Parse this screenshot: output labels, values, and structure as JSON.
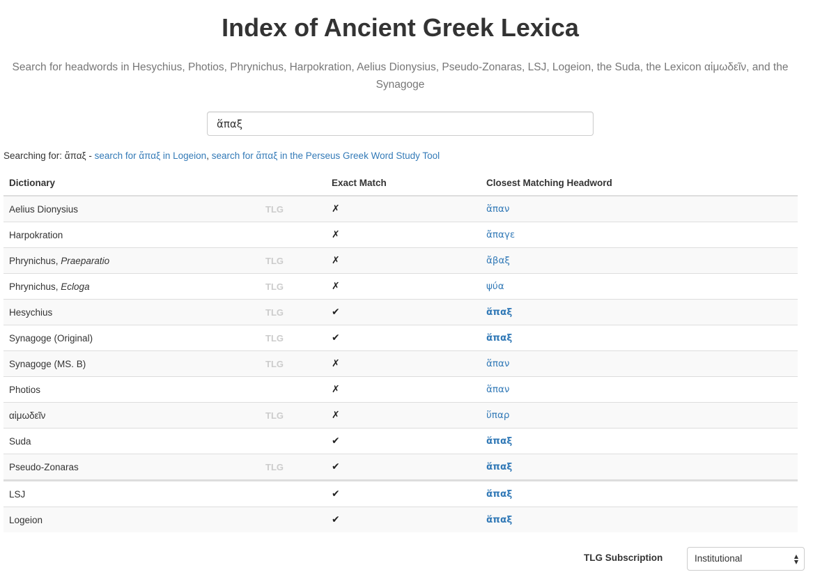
{
  "page": {
    "title": "Index of Ancient Greek Lexica",
    "subtitle": "Search for headwords in Hesychius, Photios, Phrynichus, Harpokration, Aelius Dionysius, Pseudo-Zonaras, LSJ, Logeion, the Suda, the Lexicon αἱμωδεῖν, and the Synagoge"
  },
  "search": {
    "value": "ἅπαξ",
    "searching_prefix": "Searching for: ἅπαξ - ",
    "logeion_link": "search for ἅπαξ in Logeion",
    "separator": ", ",
    "perseus_link": "search for ἅπαξ in the Perseus Greek Word Study Tool"
  },
  "table": {
    "headers": {
      "dictionary": "Dictionary",
      "tlg": "",
      "exact": "Exact Match",
      "closest": "Closest Matching Headword"
    },
    "rows": [
      {
        "name": "Aelius Dionysius",
        "italic": "",
        "tlg": "TLG",
        "exact": "✗",
        "headword": "ἅπαν",
        "bold": false
      },
      {
        "name": "Harpokration",
        "italic": "",
        "tlg": "",
        "exact": "✗",
        "headword": "ἄπαγε",
        "bold": false
      },
      {
        "name": "Phrynichus, ",
        "italic": "Praeparatio",
        "tlg": "TLG",
        "exact": "✗",
        "headword": "ἄβαξ",
        "bold": false
      },
      {
        "name": "Phrynichus, ",
        "italic": "Ecloga",
        "tlg": "TLG",
        "exact": "✗",
        "headword": "ψύα",
        "bold": false
      },
      {
        "name": "Hesychius",
        "italic": "",
        "tlg": "TLG",
        "exact": "✔",
        "headword": "ἅπαξ",
        "bold": true
      },
      {
        "name": "Synagoge (Original)",
        "italic": "",
        "tlg": "TLG",
        "exact": "✔",
        "headword": "ἅπαξ",
        "bold": true
      },
      {
        "name": "Synagoge (MS. B)",
        "italic": "",
        "tlg": "TLG",
        "exact": "✗",
        "headword": "ἅπαν",
        "bold": false
      },
      {
        "name": "Photios",
        "italic": "",
        "tlg": "",
        "exact": "✗",
        "headword": "ἅπαν",
        "bold": false
      },
      {
        "name": "αἱμωδεῖν",
        "italic": "",
        "tlg": "TLG",
        "exact": "✗",
        "headword": "ὕπαρ",
        "bold": false
      },
      {
        "name": "Suda",
        "italic": "",
        "tlg": "",
        "exact": "✔",
        "headword": "ἅπαξ",
        "bold": true
      },
      {
        "name": "Pseudo-Zonaras",
        "italic": "",
        "tlg": "TLG",
        "exact": "✔",
        "headword": "ἅπαξ",
        "bold": true
      },
      {
        "name": "LSJ",
        "italic": "",
        "tlg": "",
        "exact": "✔",
        "headword": "ἅπαξ",
        "bold": true,
        "group_start": true
      },
      {
        "name": "Logeion",
        "italic": "",
        "tlg": "",
        "exact": "✔",
        "headword": "ἅπαξ",
        "bold": true
      }
    ]
  },
  "tlg_subscription": {
    "label": "TLG Subscription",
    "selected": "Institutional"
  },
  "colors": {
    "link": "#337ab7",
    "tlg_badge": "#cccccc",
    "stripe": "#f9f9f9",
    "border": "#dddddd"
  }
}
